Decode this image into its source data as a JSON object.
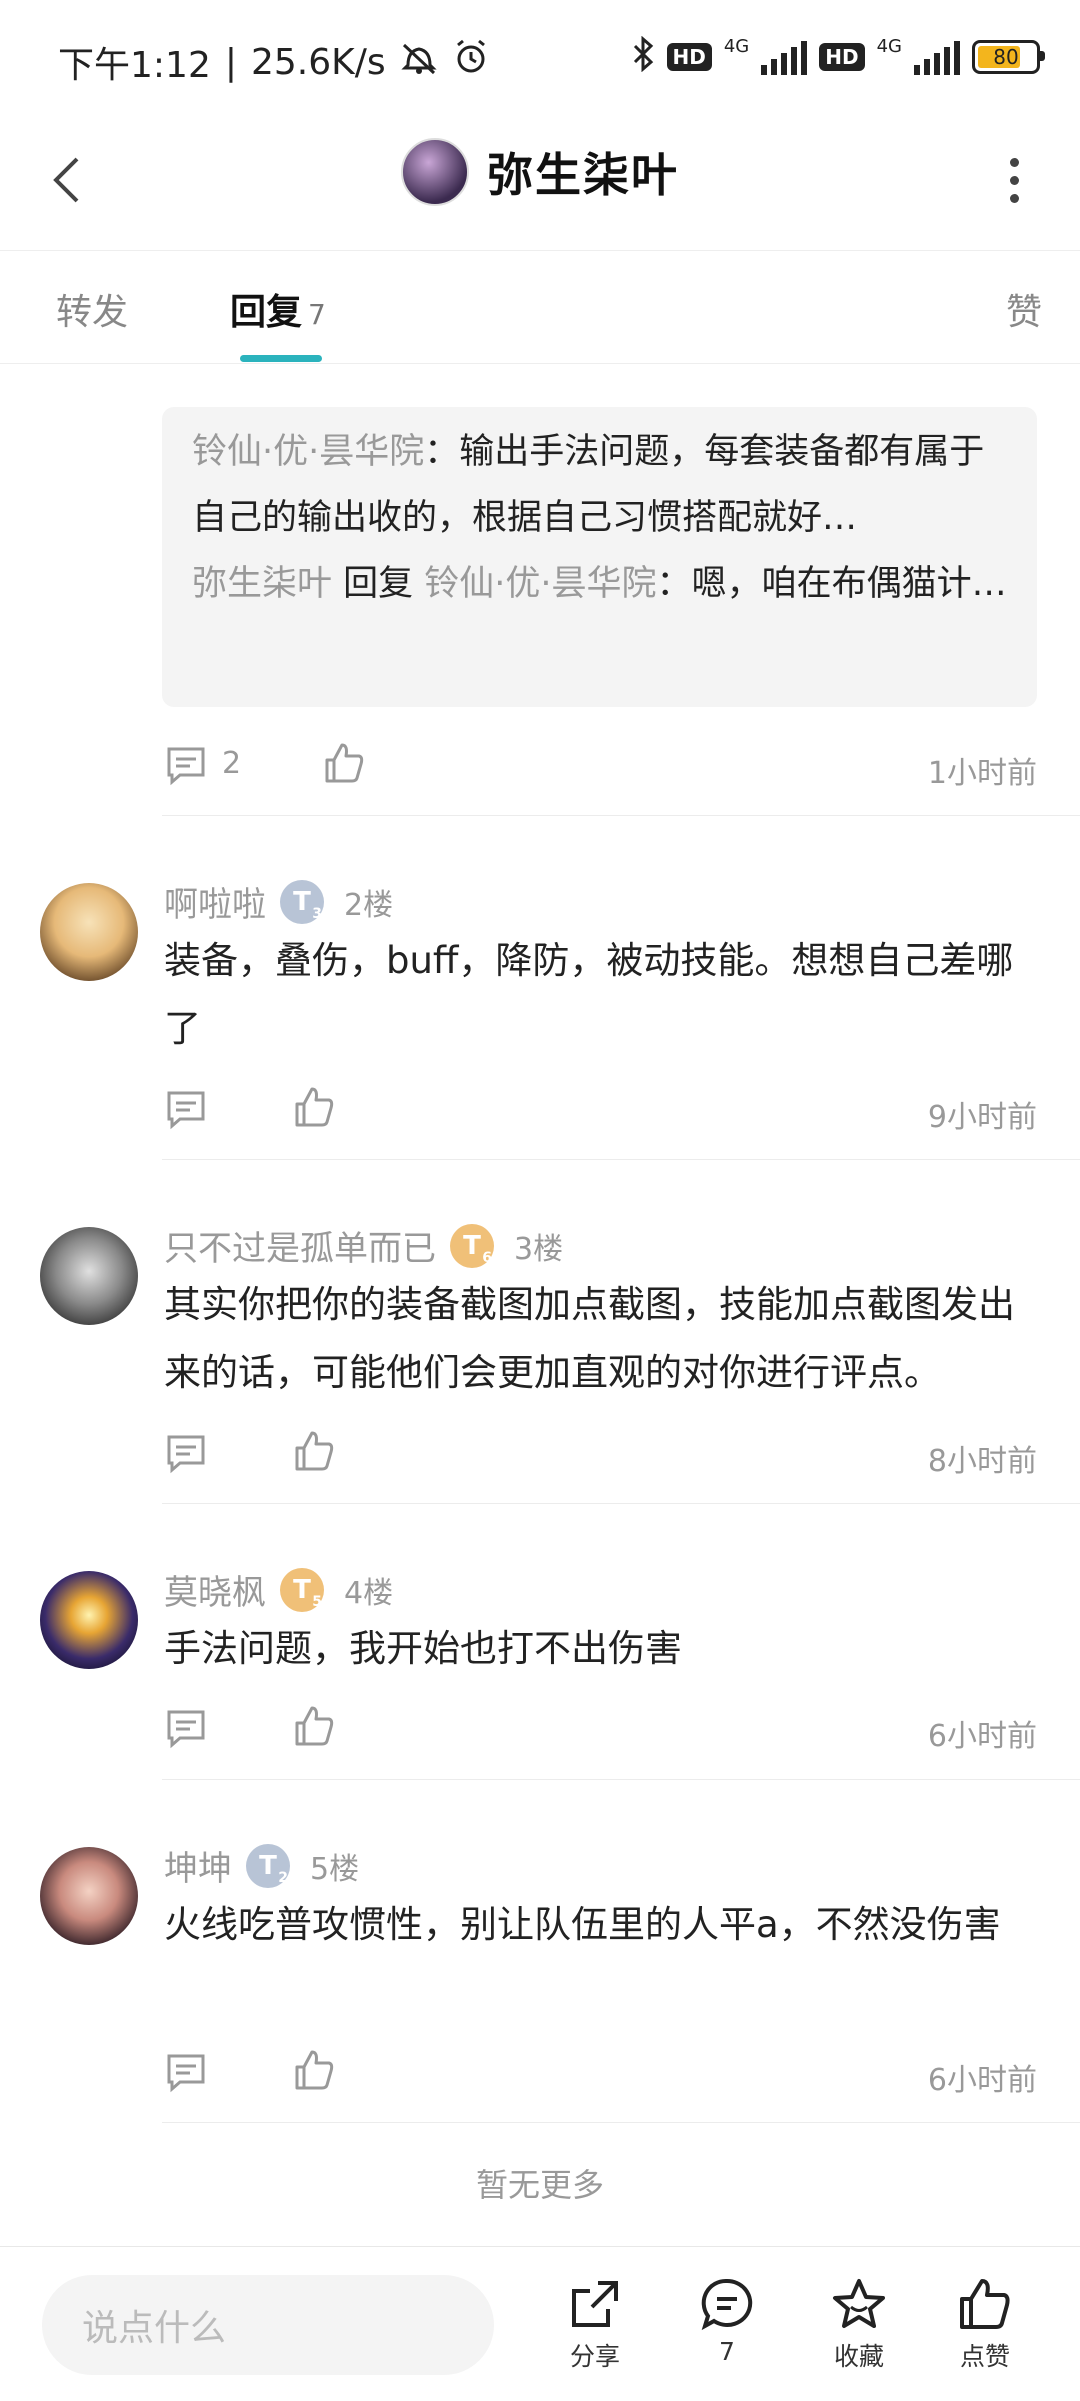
{
  "status_bar": {
    "time": "下午1:12",
    "net_speed": "25.6K/s",
    "network1": "4G",
    "network2": "4G",
    "battery": "80"
  },
  "header": {
    "title": "弥生柒叶"
  },
  "tabs": {
    "forward": "转发",
    "reply": "回复",
    "reply_count": "7",
    "like": "赞"
  },
  "first_comment": {
    "quotes": [
      {
        "name": "铃仙·优·昙华院",
        "sep": "：",
        "text": "输出手法问题，每套装备都有属于自己的输出收的，根据自己习惯搭配就好…"
      },
      {
        "name": "弥生柒叶",
        "mid": " 回复 ",
        "target": "铃仙·优·昙华院",
        "sep": "：",
        "text": "嗯，咱在布偶猫计算了半天，应该就是叠伤还不到位的原因…"
      }
    ],
    "reply_count": "2",
    "time": "1小时前"
  },
  "comments": [
    {
      "name": "啊啦啦",
      "level": "T",
      "level_num": "3",
      "floor": "2楼",
      "text": "装备，叠伤，buff，降防，被动技能。想想自己差哪了",
      "time": "9小时前"
    },
    {
      "name": "只不过是孤单而已",
      "level": "T",
      "level_num": "6",
      "floor": "3楼",
      "text": "其实你把你的装备截图加点截图，技能加点截图发出来的话，可能他们会更加直观的对你进行评点。",
      "time": "8小时前"
    },
    {
      "name": "莫晓枫",
      "level": "T",
      "level_num": "5",
      "floor": "4楼",
      "text": "手法问题，我开始也打不出伤害",
      "time": "6小时前"
    },
    {
      "name": "坤坤",
      "level": "T",
      "level_num": "2",
      "floor": "5楼",
      "text": "火线吃普攻惯性，别让队伍里的人平a，不然没伤害",
      "time": "6小时前"
    }
  ],
  "footer_note": "暂无更多",
  "bottom_bar": {
    "input_placeholder": "说点什么",
    "share": "分享",
    "comment_count": "7",
    "favorite": "收藏",
    "like": "点赞"
  },
  "colors": {
    "accent": "#2bb3bd",
    "muted_text": "#999999",
    "quote_bg": "#f4f4f4",
    "level_silver": "#b8c4d6",
    "level_gold": "#f0c078",
    "battery_fill": "#f3b51d"
  }
}
